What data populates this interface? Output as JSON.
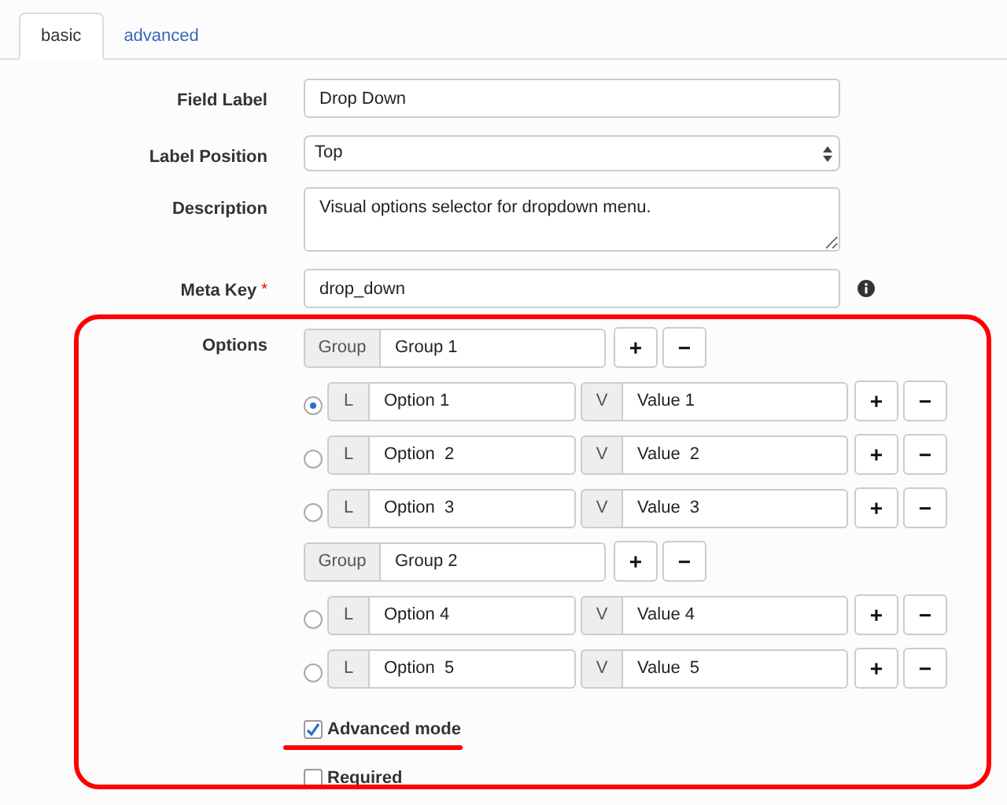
{
  "tabs": [
    {
      "label": "basic",
      "selected": true
    },
    {
      "label": "advanced",
      "selected": false
    }
  ],
  "fields": [
    {
      "kind": "text",
      "label": "Field Label",
      "value": "Drop Down"
    },
    {
      "kind": "select",
      "label": "Label Position",
      "value": "Top"
    },
    {
      "kind": "textarea",
      "label": "Description",
      "value": "Visual options selector for dropdown menu."
    },
    {
      "kind": "text",
      "label": "Meta Key",
      "required_mark": "*",
      "value": "drop_down",
      "info": true
    }
  ],
  "options": {
    "label": "Options",
    "items": [
      {
        "kind": "group",
        "addon": "Group",
        "value": "Group 1",
        "add": "+",
        "remove": "−"
      },
      {
        "kind": "option",
        "selected": true,
        "label_addon": "L",
        "label": "Option 1",
        "value_addon": "V",
        "value": "Value 1",
        "add": "+",
        "remove": "−"
      },
      {
        "kind": "option",
        "selected": false,
        "label_addon": "L",
        "label": "Option  2",
        "value_addon": "V",
        "value": "Value  2",
        "add": "+",
        "remove": "−"
      },
      {
        "kind": "option",
        "selected": false,
        "label_addon": "L",
        "label": "Option  3",
        "value_addon": "V",
        "value": "Value  3",
        "add": "+",
        "remove": "−"
      },
      {
        "kind": "group",
        "addon": "Group",
        "value": "Group 2",
        "add": "+",
        "remove": "−"
      },
      {
        "kind": "option",
        "selected": false,
        "label_addon": "L",
        "label": "Option 4",
        "value_addon": "V",
        "value": "Value 4",
        "add": "+",
        "remove": "−"
      },
      {
        "kind": "option",
        "selected": false,
        "label_addon": "L",
        "label": "Option  5",
        "value_addon": "V",
        "value": "Value  5",
        "add": "+",
        "remove": "−"
      }
    ]
  },
  "checkboxes": [
    {
      "label": "Advanced mode",
      "checked": true,
      "underlined": true
    },
    {
      "label": "Required",
      "checked": false,
      "underlined": false
    }
  ]
}
